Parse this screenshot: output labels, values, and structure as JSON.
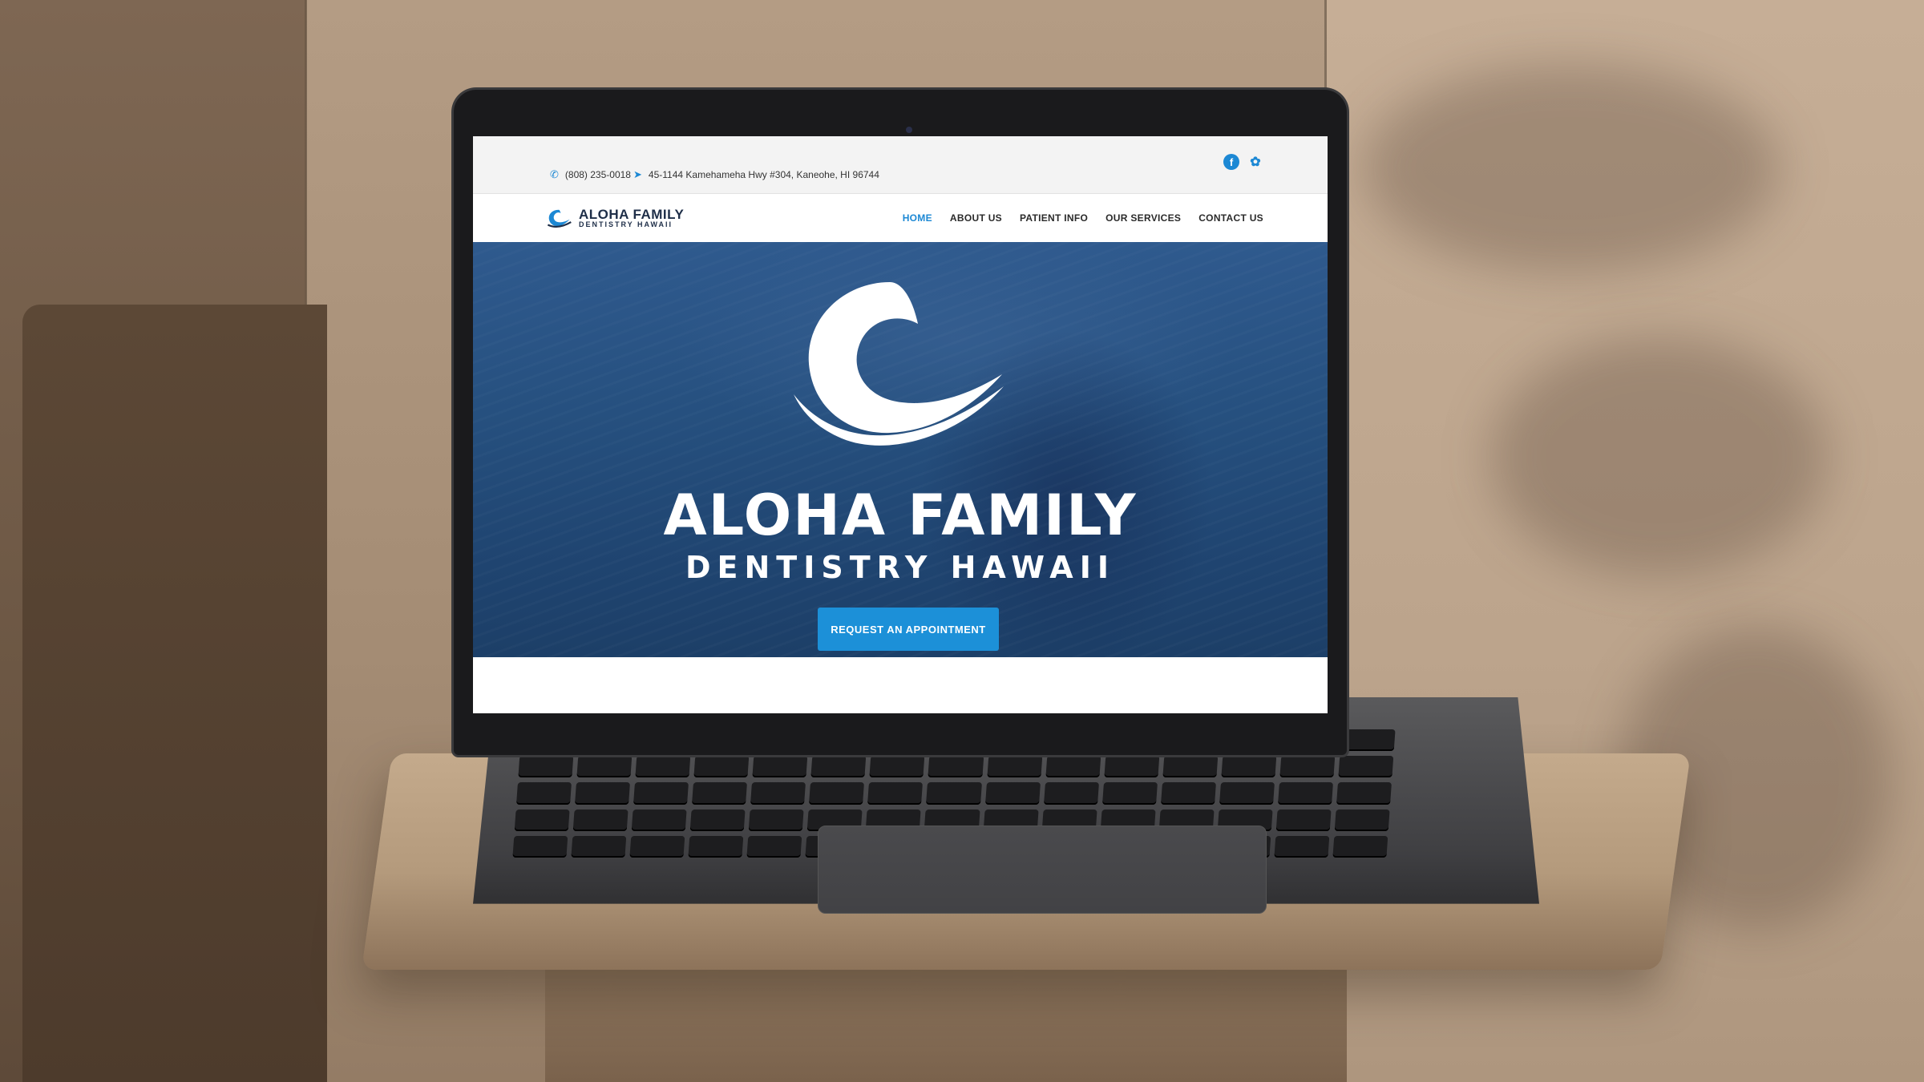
{
  "site": {
    "topbar": {
      "phone": "(808) 235-0018",
      "address": "45-1144 Kamehameha Hwy #304, Kaneohe, HI 96744",
      "phone_icon": "phone-icon",
      "address_icon": "location-arrow-icon",
      "social": [
        "facebook-icon",
        "yelp-icon"
      ]
    },
    "logo": {
      "line1": "ALOHA FAMILY",
      "line2": "DENTISTRY HAWAII"
    },
    "nav": {
      "items": [
        "HOME",
        "ABOUT US",
        "PATIENT INFO",
        "OUR SERVICES",
        "CONTACT US"
      ],
      "active": "HOME"
    },
    "hero": {
      "title": "ALOHA FAMILY",
      "subtitle": "DENTISTRY HAWAII",
      "cta_label": "REQUEST AN APPOINTMENT"
    },
    "colors": {
      "accent": "#1c88d4",
      "hero_blue": "#26507f",
      "logo_navy": "#1e2e48"
    }
  }
}
